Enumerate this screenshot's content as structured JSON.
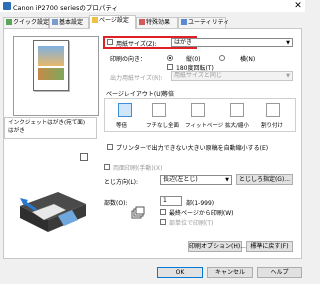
{
  "window": {
    "title": "Canon iP2700 seriesのプロパティ",
    "close": "✕"
  },
  "tabs": [
    {
      "label": "クイック設定",
      "icon": "quick-setup-icon"
    },
    {
      "label": "基本設定",
      "icon": "main-icon"
    },
    {
      "label": "ページ設定",
      "icon": "page-setup-icon"
    },
    {
      "label": "特殊効果",
      "icon": "effects-icon"
    },
    {
      "label": "ユーティリティ",
      "icon": "maintenance-icon"
    }
  ],
  "preview": {
    "info_line1": "インクジェットはがき(宛て面)",
    "info_line2": "はがき"
  },
  "paper_size": {
    "label": "用紙サイズ(Z):",
    "value": "はがき"
  },
  "orientation": {
    "label": "印刷の向き：",
    "portrait": "縦(0)",
    "landscape": "横(N)",
    "rotate180": "180度回転(T)"
  },
  "output_size": {
    "label": "出力用紙サイズ(R):",
    "value": "用紙サイズと同じ"
  },
  "page_layout": {
    "label": "ページレイアウト(U):",
    "value": "等倍",
    "options": [
      "等倍",
      "フチなし全面",
      "フィットページ",
      "拡大/縮小",
      "割り付け"
    ]
  },
  "shrink_check": {
    "label": "プリンターで出力できない大きい原稿を自動縮小する(E)"
  },
  "duplex": {
    "label": "両面印刷(手動)(X)"
  },
  "binding": {
    "label": "とじ方向(L):",
    "value": "長辺(左とじ)",
    "button": "とじしろ指定(G)..."
  },
  "copies": {
    "label": "部数(O):",
    "value": "1",
    "range": "部(1-999)",
    "last_page_first": "最終ページから印刷(W)",
    "collate": "部単位で印刷(T)"
  },
  "buttons": {
    "print_options": "印刷オプション(H)...",
    "defaults": "標準に戻す(F)",
    "ok": "OK",
    "cancel": "キャンセル",
    "help": "ヘルプ"
  },
  "colors": {
    "highlight": "#e01f26",
    "accent": "#0078d7",
    "selected_icon": "#cfe6fb"
  }
}
